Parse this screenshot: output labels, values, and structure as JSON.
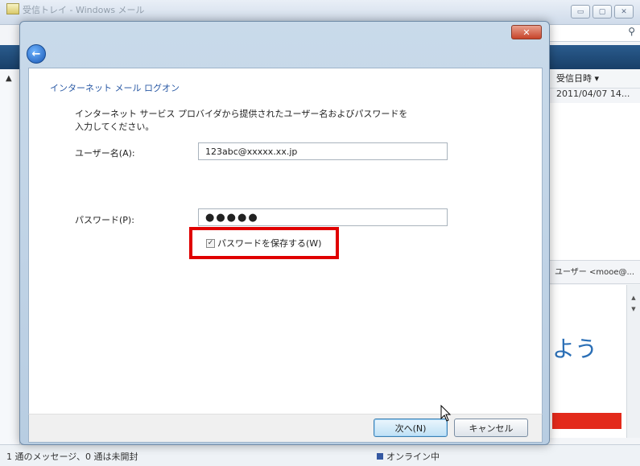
{
  "background_window": {
    "title": "受信トレイ - Windows メール",
    "controls": [
      "▭",
      "▢",
      "✕"
    ],
    "column_header": "受信日時",
    "first_row_date": "2011/04/07 14...",
    "preview_from": "ユーザー <mooe@...",
    "preview_text": "よう",
    "status_left": "1 通のメッセージ、0 通は未開封",
    "status_online": "オンライン中"
  },
  "dialog": {
    "close_label": "✕",
    "back_label": "←",
    "heading": "インターネット メール ログオン",
    "description": "インターネット サービス プロバイダから提供されたユーザー名およびパスワードを入力してください。",
    "username_label": "ユーザー名(A):",
    "username_value": "123abc@xxxxx.xx.jp",
    "password_label": "パスワード(P):",
    "password_value": "●●●●●",
    "remember_label": "パスワードを保存する(W)",
    "remember_checked": true,
    "next_button": "次へ(N)",
    "cancel_button": "キャンセル"
  },
  "colors": {
    "highlight": "#e00000",
    "heading": "#2b5aa5"
  }
}
